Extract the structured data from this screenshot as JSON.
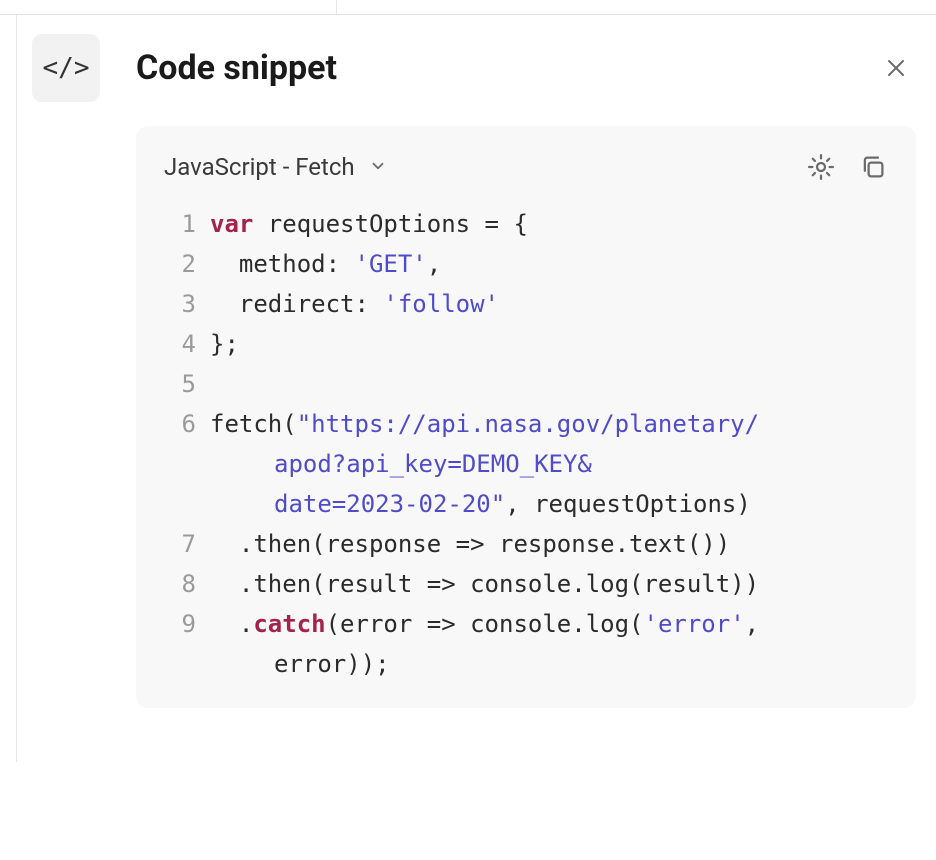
{
  "header": {
    "badge_glyph": "</>",
    "title": "Code snippet"
  },
  "toolbar": {
    "language_label": "JavaScript - Fetch"
  },
  "code": {
    "line1": {
      "kw": "var",
      "rest": " requestOptions = {"
    },
    "line2": {
      "indent": "  ",
      "prefix": "method: ",
      "str": "'GET'",
      "suffix": ","
    },
    "line3": {
      "indent": "  ",
      "prefix": "redirect: ",
      "str": "'follow'"
    },
    "line4": "};",
    "line5": "",
    "line6": {
      "prefix": "fetch(",
      "str_a": "\"https://api.nasa.gov/planetary/",
      "str_b": "apod?api_key=DEMO_KEY&",
      "str_c": "date=2023-02-20\"",
      "suffix": ", requestOptions)"
    },
    "line7": "  .then(response => response.text())",
    "line8": "  .then(result => console.log(result))",
    "line9": {
      "indent": "  ",
      "dot": ".",
      "kw": "catch",
      "args_a": "(error => console.log(",
      "str": "'error'",
      "args_b": ",",
      "wrap": "error));"
    }
  }
}
